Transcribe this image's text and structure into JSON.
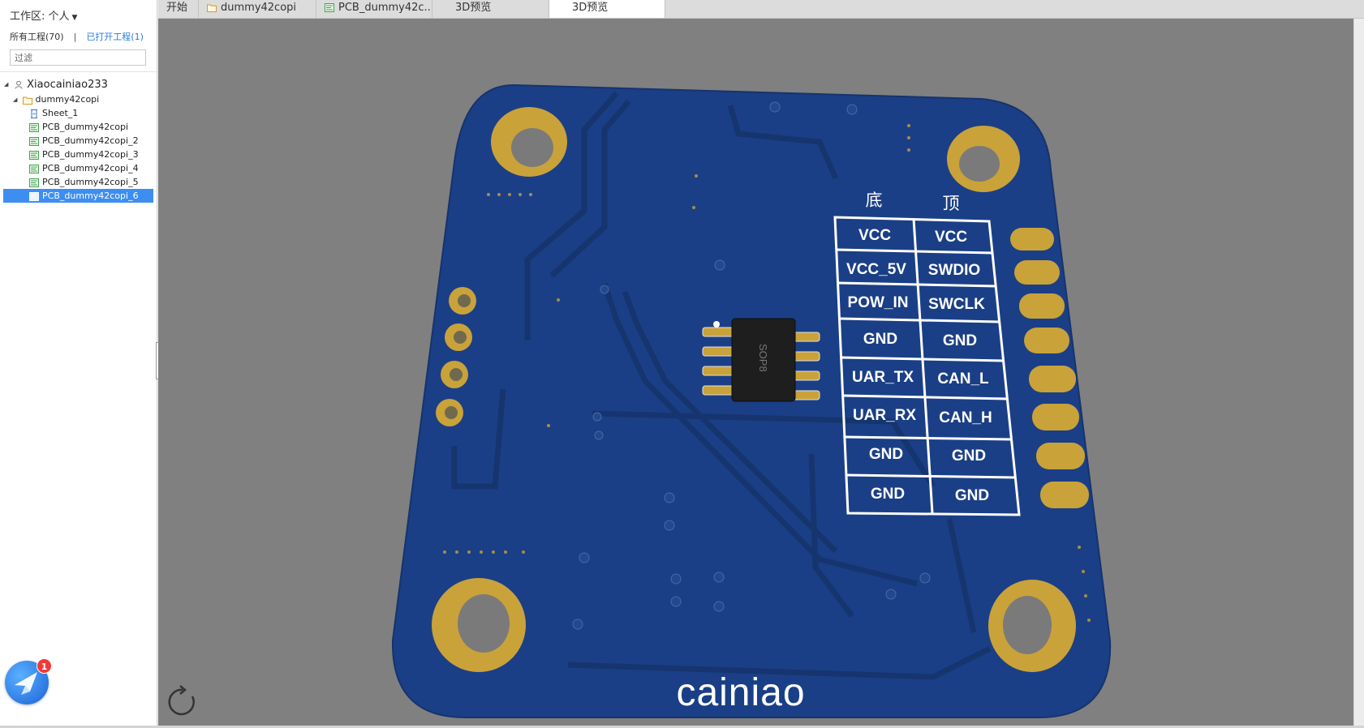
{
  "sidebar": {
    "workspace_label": "工作区: 个人",
    "all_projects": "所有工程(70)",
    "separator": "|",
    "open_projects": "已打开工程(1)",
    "filter_placeholder": "过滤",
    "tree": {
      "user": "Xiaocainiao233",
      "project": "dummy42copi",
      "items": [
        "Sheet_1",
        "PCB_dummy42copi",
        "PCB_dummy42copi_2",
        "PCB_dummy42copi_3",
        "PCB_dummy42copi_4",
        "PCB_dummy42copi_5",
        "PCB_dummy42copi_6"
      ],
      "selected": "PCB_dummy42copi_6"
    }
  },
  "tabs": [
    {
      "label": "开始",
      "icon": "none"
    },
    {
      "label": "dummy42copi",
      "icon": "folder-icon"
    },
    {
      "label": "PCB_dummy42c...",
      "icon": "pcb-icon"
    },
    {
      "label": "3D预览",
      "icon": "none"
    },
    {
      "label": "3D预览",
      "icon": "none",
      "active": true
    }
  ],
  "board": {
    "chip_label": "SOP8",
    "side_bottom": "底",
    "side_top": "顶",
    "pin_table": [
      [
        "VCC",
        "VCC"
      ],
      [
        "VCC_5V",
        "SWDIO"
      ],
      [
        "POW_IN",
        "SWCLK"
      ],
      [
        "GND",
        "GND"
      ],
      [
        "UAR_TX",
        "CAN_L"
      ],
      [
        "UAR_RX",
        "CAN_H"
      ],
      [
        "GND",
        "GND"
      ],
      [
        "GND",
        "GND"
      ]
    ],
    "brand": "cainiao",
    "colors": {
      "board": "#1b3f86",
      "gold": "#c9a23a",
      "background": "#808080"
    }
  },
  "assistant": {
    "badge": "1"
  },
  "icons": {
    "reset_view": "rotate-icon"
  }
}
